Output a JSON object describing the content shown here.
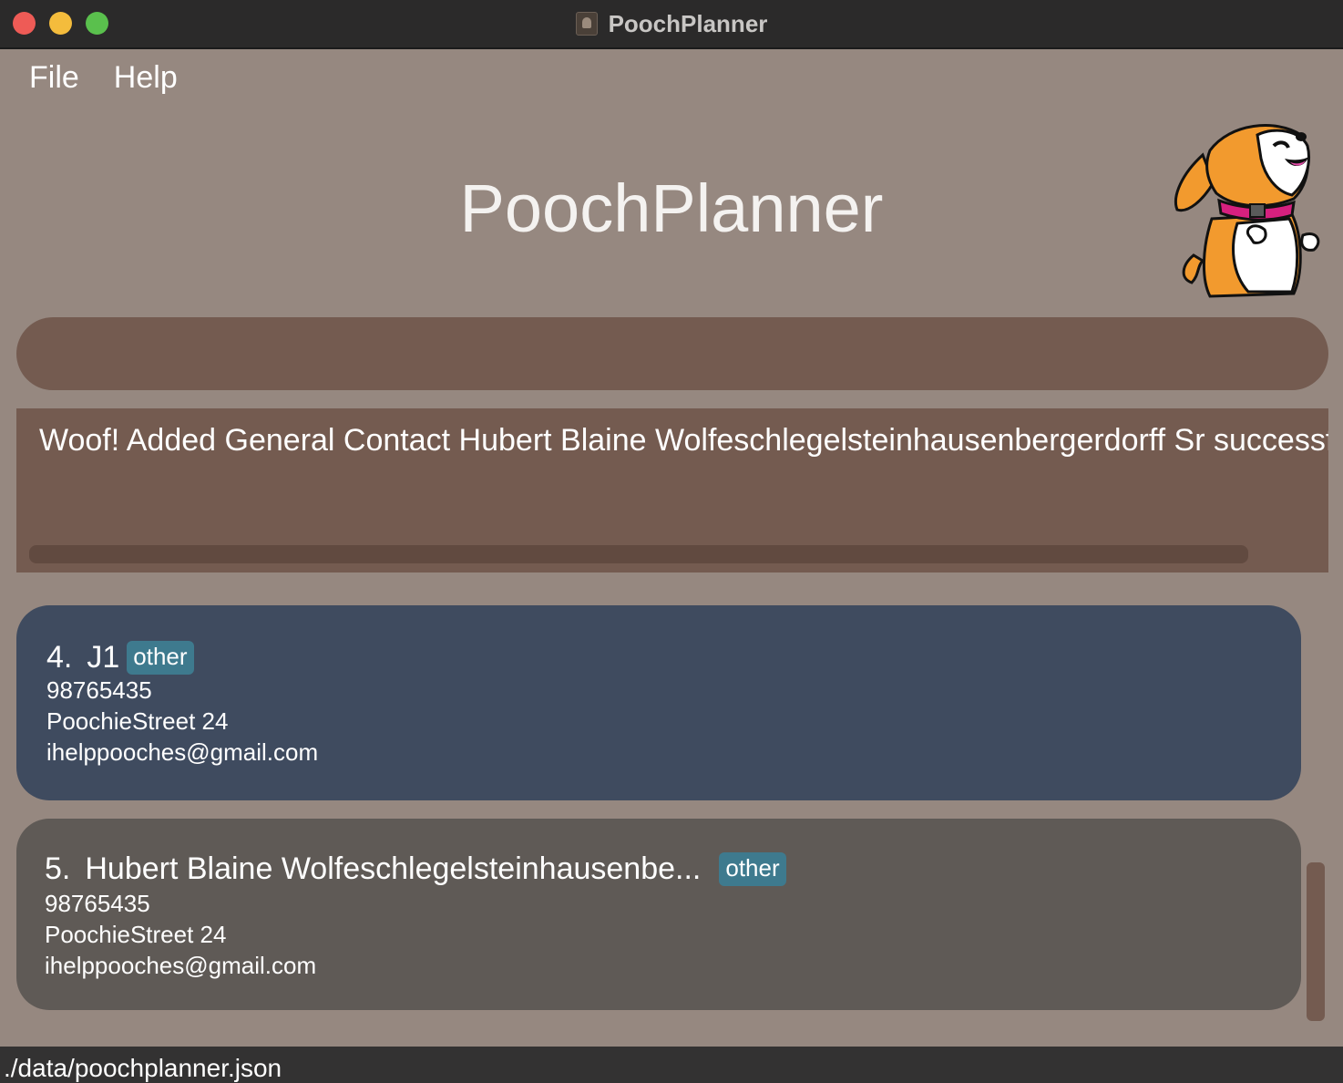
{
  "window": {
    "title": "PoochPlanner"
  },
  "menu": {
    "items": [
      {
        "label": "File"
      },
      {
        "label": "Help"
      }
    ]
  },
  "header": {
    "title": "PoochPlanner",
    "mascot_icon": "dog-mascot-icon"
  },
  "command": {
    "value": "",
    "placeholder": ""
  },
  "result": {
    "message": "Woof! Added General Contact Hubert Blaine Wolfeschlegelsteinhausenbergerdorff Sr successfully"
  },
  "contacts": [
    {
      "index": "4.",
      "name": "J1",
      "tag": "other",
      "phone": "98765435",
      "address": "PoochieStreet 24",
      "email": "ihelppooches@gmail.com",
      "color": "#3f4b5f"
    },
    {
      "index": "5.",
      "name": "Hubert Blaine Wolfeschlegelsteinhausenbe...",
      "tag": "other",
      "phone": "98765435",
      "address": "PoochieStreet 24",
      "email": "ihelppooches@gmail.com",
      "color": "#5f5a56"
    }
  ],
  "status": {
    "path": "./data/poochplanner.json"
  },
  "colors": {
    "background": "#968880",
    "panel": "#745b50",
    "selected_card": "#3f4b5f",
    "card": "#5f5a56",
    "tag": "#3e7a8e"
  }
}
